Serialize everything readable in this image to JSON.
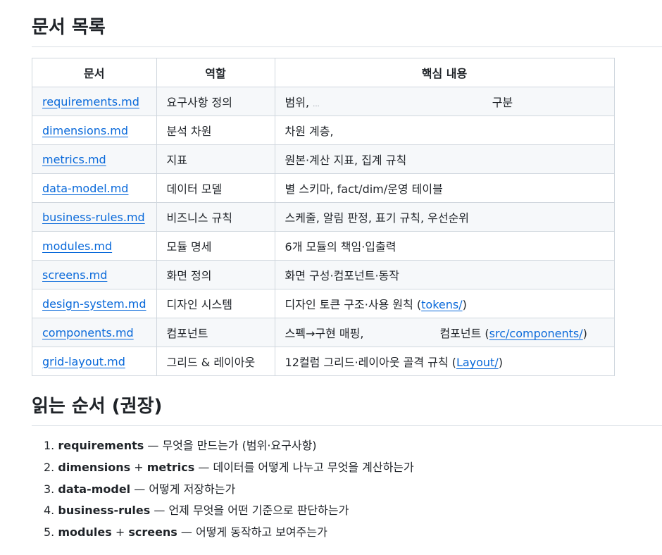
{
  "sections": {
    "docs_title": "문서 목록",
    "order_title": "읽는 순서 (권장)"
  },
  "table": {
    "headers": [
      "문서",
      "역할",
      "핵심 내용"
    ],
    "rows": [
      {
        "doc": "requirements.md",
        "role": "요구사항 정의",
        "core_a": "범위, ",
        "core_dots": "...",
        "core_b": "구분"
      },
      {
        "doc": "dimensions.md",
        "role": "분석 차원",
        "core_a": "차원 계층,"
      },
      {
        "doc": "metrics.md",
        "role": "지표",
        "core_a": "원본·계산 지표, 집계 규칙"
      },
      {
        "doc": "data-model.md",
        "role": "데이터 모델",
        "core_a": "별 스키마, fact/dim/운영 테이블"
      },
      {
        "doc": "business-rules.md",
        "role": "비즈니스 규칙",
        "core_a": "스케줄, 알림 판정, 표기 규칙, 우선순위"
      },
      {
        "doc": "modules.md",
        "role": "모듈 명세",
        "core_a": "6개 모듈의 책임·입출력"
      },
      {
        "doc": "screens.md",
        "role": "화면 정의",
        "core_a": "화면 구성·컴포넌트·동작"
      },
      {
        "doc": "design-system.md",
        "role": "디자인 시스템",
        "core_a": "디자인 토큰 구조·사용 원칙 (",
        "core_link": "tokens/",
        "core_b": ")"
      },
      {
        "doc": "components.md",
        "role": "컴포넌트",
        "core_a": "스펙→구현 매핑,",
        "core_c": "컴포넌트 (",
        "core_link": "src/components/",
        "core_b": ")"
      },
      {
        "doc": "grid-layout.md",
        "role": "그리드 & 레이아웃",
        "core_a": "12컬럼 그리드·레이아웃 골격 규칙 (",
        "core_link": "Layout/",
        "core_b": ")"
      }
    ]
  },
  "order": [
    {
      "num": "1.",
      "bold": "requirements",
      "rest": " — 무엇을 만드는가 (범위·요구사항)"
    },
    {
      "num": "2.",
      "bold": "dimensions",
      "mid": " + ",
      "bold2": "metrics",
      "rest": " — 데이터를 어떻게 나누고 무엇을 계산하는가"
    },
    {
      "num": "3.",
      "bold": "data-model",
      "rest": " — 어떻게 저장하는가"
    },
    {
      "num": "4.",
      "bold": "business-rules",
      "rest": " — 언제 무엇을 어떤 기준으로 판단하는가"
    },
    {
      "num": "5.",
      "bold": "modules",
      "mid": " + ",
      "bold2": "screens",
      "rest": " — 어떻게 동작하고 보여주는가"
    }
  ]
}
